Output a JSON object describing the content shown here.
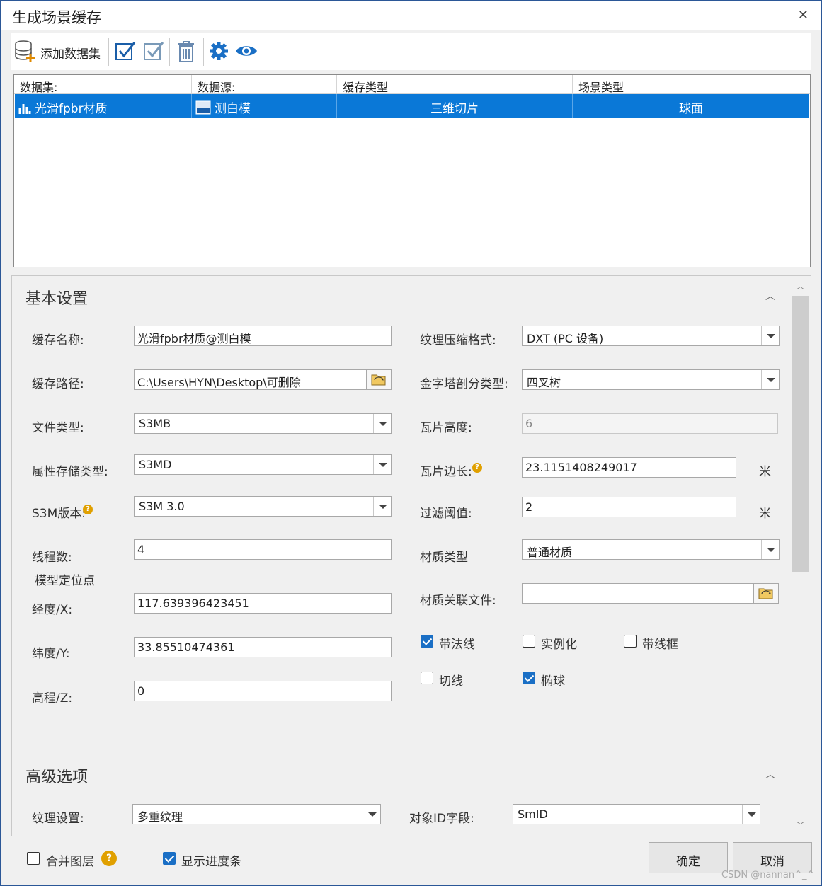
{
  "window": {
    "title": "生成场景缓存",
    "close_icon": "close-icon"
  },
  "toolbar": {
    "add_dataset_label": "添加数据集"
  },
  "grid": {
    "headers": [
      "数据集:",
      "数据源:",
      "缓存类型",
      "场景类型"
    ],
    "rows": [
      {
        "dataset": "光滑fpbr材质",
        "datasource": "测白模",
        "cache_type": "三维切片",
        "scene_type": "球面"
      }
    ]
  },
  "basic": {
    "title": "基本设置",
    "cache_name_label": "缓存名称:",
    "cache_name": "光滑fpbr材质@测白模",
    "cache_path_label": "缓存路径:",
    "cache_path": "C:\\Users\\HYN\\Desktop\\可删除",
    "file_type_label": "文件类型:",
    "file_type": "S3MB",
    "attr_storage_label": "属性存储类型:",
    "attr_storage": "S3MD",
    "s3m_version_label": "S3M版本:",
    "s3m_version": "S3M 3.0",
    "threads_label": "线程数:",
    "threads": "4",
    "anchor_group": "模型定位点",
    "lon_label": "经度/X:",
    "lon": "117.639396423451",
    "lat_label": "纬度/Y:",
    "lat": "33.85510474361",
    "elev_label": "高程/Z:",
    "elev": "0",
    "texture_fmt_label": "纹理压缩格式:",
    "texture_fmt": "DXT (PC 设备)",
    "pyramid_label": "金字塔剖分类型:",
    "pyramid": "四叉树",
    "tile_height_label": "瓦片高度:",
    "tile_height": "6",
    "tile_side_label": "瓦片边长:",
    "tile_side": "23.1151408249017",
    "tile_side_unit": "米",
    "filter_label": "过滤阈值:",
    "filter": "2",
    "filter_unit": "米",
    "material_type_label": "材质类型",
    "material_type": "普通材质",
    "material_file_label": "材质关联文件:",
    "material_file": "",
    "cb_normal": "带法线",
    "cb_instance": "实例化",
    "cb_wireframe": "带线框",
    "cb_tangent": "切线",
    "cb_ellipsoid": "椭球"
  },
  "advanced": {
    "title": "高级选项",
    "texture_label": "纹理设置:",
    "texture": "多重纹理",
    "objid_label": "对象ID字段:",
    "objid": "SmID"
  },
  "footer": {
    "merge_label": "合并图层",
    "progress_label": "显示进度条",
    "ok_label": "确定",
    "cancel_label": "取消"
  },
  "watermark": "CSDN @nannan^_^",
  "colors": {
    "accent": "#0a78d7",
    "checkbox": "#1a6fc5",
    "help": "#e0a000"
  }
}
